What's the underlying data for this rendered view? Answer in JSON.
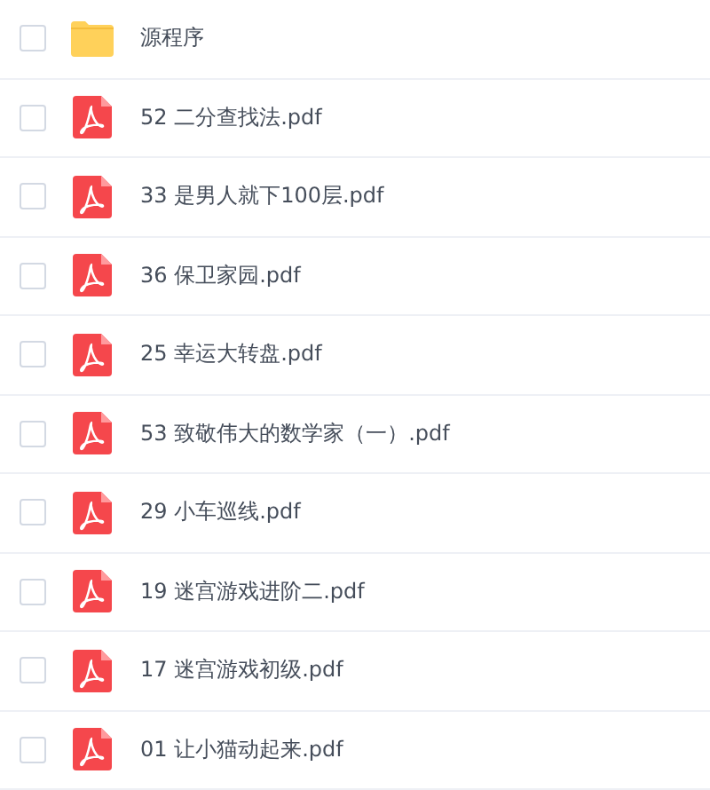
{
  "files": [
    {
      "kind": "folder",
      "name": "源程序",
      "checked": false
    },
    {
      "kind": "pdf",
      "name": "52 二分查找法.pdf",
      "checked": false
    },
    {
      "kind": "pdf",
      "name": "33 是男人就下100层.pdf",
      "checked": false
    },
    {
      "kind": "pdf",
      "name": "36 保卫家园.pdf",
      "checked": false
    },
    {
      "kind": "pdf",
      "name": "25 幸运大转盘.pdf",
      "checked": false
    },
    {
      "kind": "pdf",
      "name": "53 致敬伟大的数学家（一）.pdf",
      "checked": false
    },
    {
      "kind": "pdf",
      "name": "29 小车巡线.pdf",
      "checked": false
    },
    {
      "kind": "pdf",
      "name": "19 迷宫游戏进阶二.pdf",
      "checked": false
    },
    {
      "kind": "pdf",
      "name": "17 迷宫游戏初级.pdf",
      "checked": false
    },
    {
      "kind": "pdf",
      "name": "01 让小猫动起来.pdf",
      "checked": false
    }
  ]
}
